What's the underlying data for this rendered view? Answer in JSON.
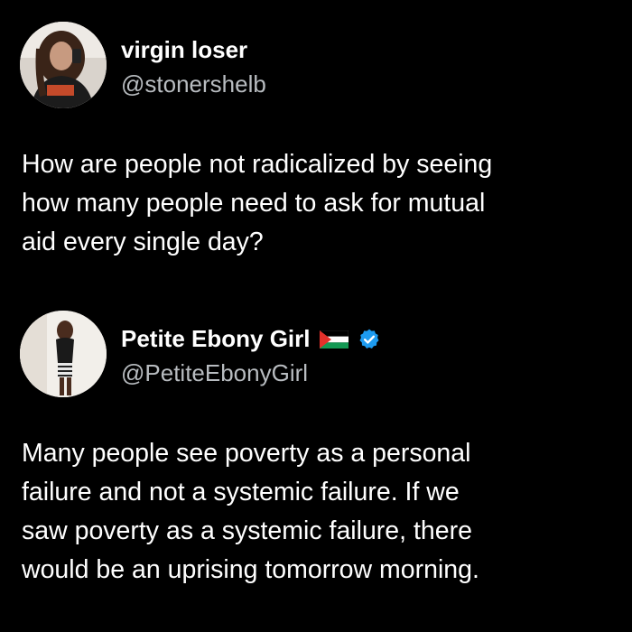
{
  "tweets": [
    {
      "display_name": "virgin loser",
      "handle": "@stonershelb",
      "avatar_icon": "user-avatar-photo",
      "body_lines": [
        "How are people not radicalized by seeing",
        "how many people need to ask for mutual",
        "aid every single day?"
      ]
    },
    {
      "display_name": "Petite Ebony Girl",
      "handle": "@PetiteEbonyGirl",
      "avatar_icon": "user-avatar-photo",
      "badges": [
        "palestine-flag-icon",
        "verified-badge-icon"
      ],
      "body_lines": [
        "Many people see poverty as a personal",
        "failure and not a systemic failure. If we",
        "saw poverty as a systemic failure, there",
        "would be an uprising tomorrow morning."
      ]
    }
  ],
  "colors": {
    "background": "#000000",
    "text": "#ffffff",
    "handle": "#b8bcc0",
    "verified": "#1d9bf0"
  }
}
